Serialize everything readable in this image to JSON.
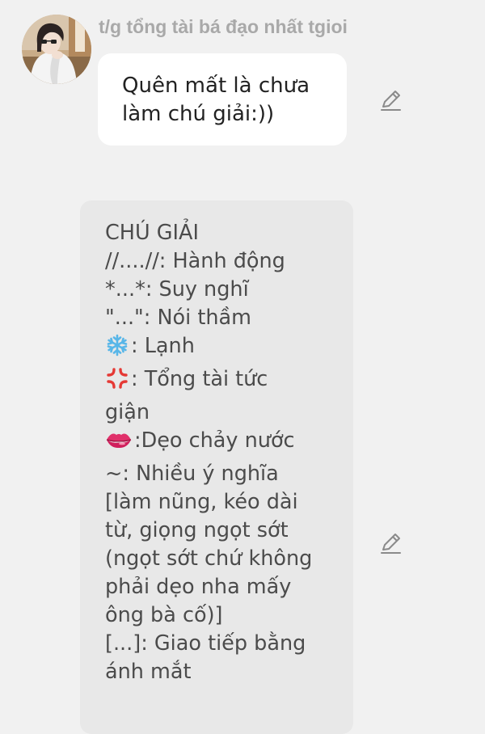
{
  "sender": {
    "name": "t/g tổng tài bá đạo nhất tgioi"
  },
  "messages": [
    {
      "lines": [
        "Quên mất là chưa",
        "làm chú giải:))"
      ]
    },
    {
      "lines": [
        "CHÚ GIẢI",
        "//....//: Hành động",
        "*...*: Suy nghĩ",
        "\"...\": Nói thầm",
        ": Lạnh",
        ": Tổng tài tức",
        "giận",
        ":Dẹo chảy nước",
        "~: Nhiều ý nghĩa",
        "[làm nũng, kéo dài",
        "từ, giọng ngọt sớt",
        "(ngọt sớt chứ không",
        "phải dẹo nha mấy",
        "ông bà cố)]",
        "[...]: Giao tiếp bằng",
        "ánh mắt"
      ],
      "emojis": {
        "cold": "snowflake-icon",
        "angry": "anger-symbol-icon",
        "lips": "lips-icon"
      }
    }
  ],
  "icons": {
    "edit": "pencil-edit-icon"
  },
  "colors": {
    "background": "#f1f1f1",
    "bubble_white": "#ffffff",
    "bubble_gray": "#e8e8e8",
    "name_gray": "#a9a9a9",
    "snowflake_blue": "#58b6e8",
    "anger_red": "#e53935",
    "lips_pink": "#e0306a"
  }
}
